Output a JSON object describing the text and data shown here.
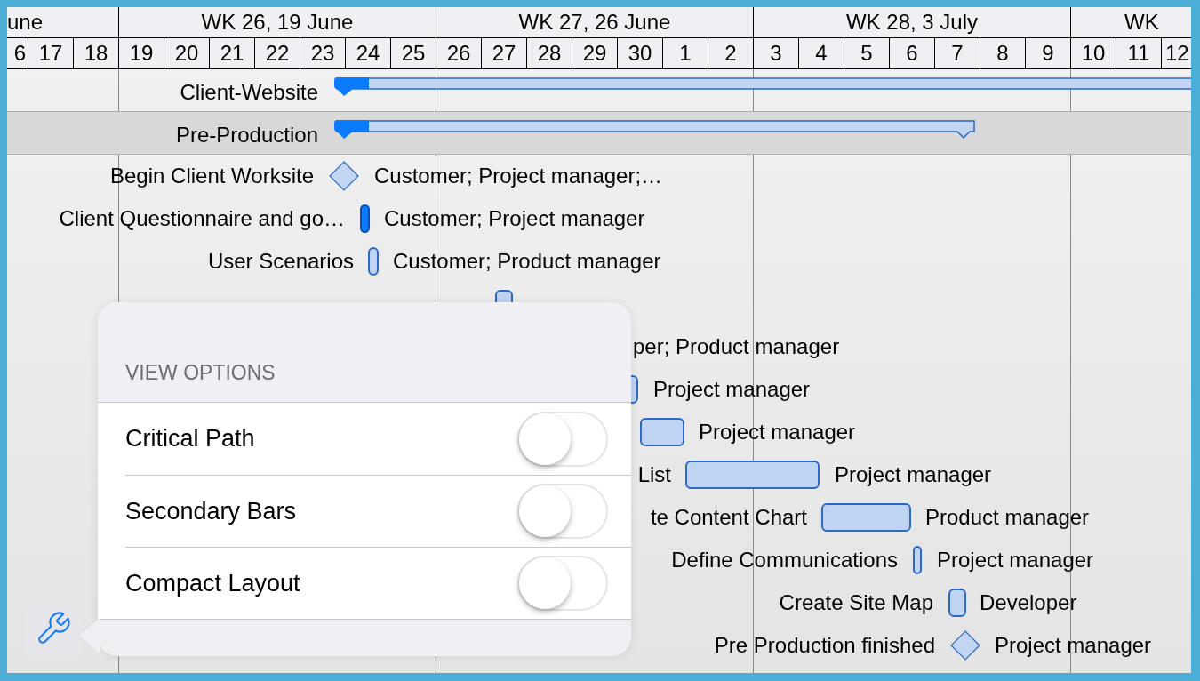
{
  "timeline": {
    "weeks": [
      "une",
      "WK 26, 19 June",
      "WK 27, 26 June",
      "WK 28, 3 July",
      "WK"
    ],
    "days": [
      "6",
      "17",
      "18",
      "19",
      "20",
      "21",
      "22",
      "23",
      "24",
      "25",
      "26",
      "27",
      "28",
      "29",
      "30",
      "1",
      "2",
      "3",
      "4",
      "5",
      "6",
      "7",
      "8",
      "9",
      "10",
      "11",
      "12"
    ]
  },
  "summaries": [
    {
      "name": "Client-Website",
      "shaded": false
    },
    {
      "name": "Pre-Production",
      "shaded": true
    }
  ],
  "tasks": [
    {
      "name": "Begin Client Worksite",
      "kind": "milestone",
      "resources": "Customer; Project manager;…"
    },
    {
      "name": "Client Questionnaire and go…",
      "kind": "task",
      "critical": true,
      "resources": "Customer; Project manager"
    },
    {
      "name": "User Scenarios",
      "kind": "task",
      "critical": false,
      "resources": "Customer; Product manager"
    },
    {
      "kind": "task",
      "critical": false
    },
    {
      "kind": "none",
      "resources": "per; Product manager"
    },
    {
      "kind": "task",
      "critical": false,
      "resources": "Project manager"
    },
    {
      "kind": "task",
      "critical": false,
      "resources": "Project manager"
    },
    {
      "name": "List",
      "kind": "task",
      "critical": false,
      "resources": "Project manager"
    },
    {
      "name": "te Content Chart",
      "kind": "task",
      "critical": false,
      "resources": "Product manager"
    },
    {
      "name": "Define Communications",
      "kind": "task",
      "critical": false,
      "resources": "Project manager"
    },
    {
      "name": "Create Site Map",
      "kind": "task",
      "critical": false,
      "resources": "Developer"
    },
    {
      "name": "Pre Production finished",
      "kind": "milestone",
      "resources": "Project manager"
    }
  ],
  "view_options": {
    "header": "VIEW OPTIONS",
    "options": [
      {
        "label": "Critical Path",
        "on": false
      },
      {
        "label": "Secondary Bars",
        "on": false
      },
      {
        "label": "Compact Layout",
        "on": false
      }
    ]
  }
}
